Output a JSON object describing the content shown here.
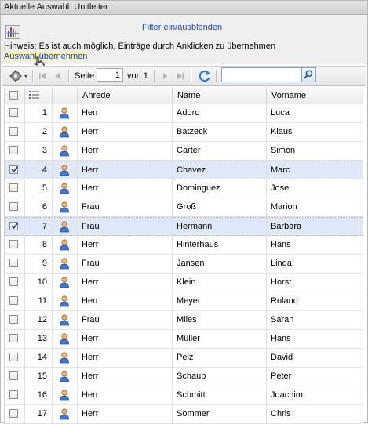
{
  "window": {
    "title": "Aktuelle Auswahl: Unitleiter"
  },
  "upper": {
    "filter_link": "Filter ein/ausblenden",
    "hint": "Hinweis: Es ist auch möglich, Einträge durch Anklicken zu übernehmen",
    "accept_link": "Auswahl übernehmen"
  },
  "pager": {
    "page_label": "Seite",
    "page_value": "1",
    "of_label": "von 1",
    "search_value": ""
  },
  "columns": {
    "anrede": "Anrede",
    "name": "Name",
    "vorname": "Vorname"
  },
  "rows": [
    {
      "n": "1",
      "anrede": "Herr",
      "name": "Adoro",
      "vorname": "Luca",
      "checked": false
    },
    {
      "n": "2",
      "anrede": "Herr",
      "name": "Batzeck",
      "vorname": "Klaus",
      "checked": false
    },
    {
      "n": "3",
      "anrede": "Herr",
      "name": "Carter",
      "vorname": "Simon",
      "checked": false
    },
    {
      "n": "4",
      "anrede": "Herr",
      "name": "Chavez",
      "vorname": "Marc",
      "checked": true
    },
    {
      "n": "5",
      "anrede": "Herr",
      "name": "Dominguez",
      "vorname": "Jose",
      "checked": false
    },
    {
      "n": "6",
      "anrede": "Frau",
      "name": "Groß",
      "vorname": "Marion",
      "checked": false
    },
    {
      "n": "7",
      "anrede": "Frau",
      "name": "Hermann",
      "vorname": "Barbara",
      "checked": true
    },
    {
      "n": "8",
      "anrede": "Herr",
      "name": "Hinterhaus",
      "vorname": "Hans",
      "checked": false
    },
    {
      "n": "9",
      "anrede": "Frau",
      "name": "Jansen",
      "vorname": "Linda",
      "checked": false
    },
    {
      "n": "10",
      "anrede": "Herr",
      "name": "Klein",
      "vorname": "Horst",
      "checked": false
    },
    {
      "n": "11",
      "anrede": "Herr",
      "name": "Meyer",
      "vorname": "Roland",
      "checked": false
    },
    {
      "n": "12",
      "anrede": "Frau",
      "name": "Miles",
      "vorname": "Sarah",
      "checked": false
    },
    {
      "n": "13",
      "anrede": "Herr",
      "name": "Müller",
      "vorname": "Hans",
      "checked": false
    },
    {
      "n": "14",
      "anrede": "Herr",
      "name": "Pelz",
      "vorname": "David",
      "checked": false
    },
    {
      "n": "15",
      "anrede": "Herr",
      "name": "Schaub",
      "vorname": "Peter",
      "checked": false
    },
    {
      "n": "16",
      "anrede": "Herr",
      "name": "Schmitt",
      "vorname": "Joachim",
      "checked": false
    },
    {
      "n": "17",
      "anrede": "Herr",
      "name": "Sommer",
      "vorname": "Chris",
      "checked": false
    }
  ],
  "icons": {
    "tool": "chart-tool-icon",
    "settings": "gear-icon",
    "first": "first-page-icon",
    "prev": "prev-page-icon",
    "next": "next-page-icon",
    "last": "last-page-icon",
    "refresh": "refresh-icon",
    "search": "search-icon",
    "user": "user-icon",
    "rownum": "row-number-icon"
  },
  "colors": {
    "link": "#1a4fd0",
    "selected_row": "#dfe8f6",
    "hint_highlight": "#fdf3b8"
  }
}
